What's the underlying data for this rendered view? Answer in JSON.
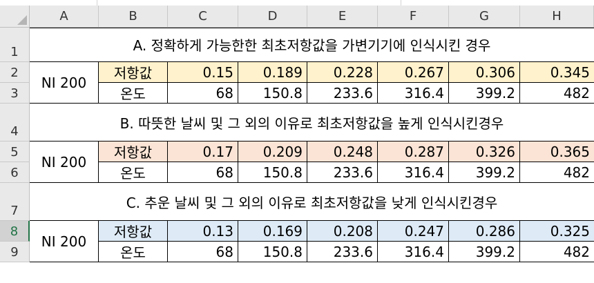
{
  "columns": [
    "A",
    "B",
    "C",
    "D",
    "E",
    "F",
    "G",
    "H"
  ],
  "rows": [
    "1",
    "2",
    "3",
    "4",
    "5",
    "6",
    "7",
    "8",
    "9"
  ],
  "selected_row": "8",
  "colors": {
    "yellow": "#fff2cc",
    "peach": "#fbe4d5",
    "blue": "#deebf7",
    "select_green": "#217346"
  },
  "sections": [
    {
      "title": "A. 정확하게 가능한한 최초저항값을 가변기기에 인식시킨 경우",
      "label": "NI 200",
      "resistance_label": "저항값",
      "resistance": [
        "0.15",
        "0.189",
        "0.228",
        "0.267",
        "0.306",
        "0.345"
      ],
      "temperature_label": "온도",
      "temperature": [
        "68",
        "150.8",
        "233.6",
        "316.4",
        "399.2",
        "482"
      ]
    },
    {
      "title": "B. 따뜻한 날씨 및 그 외의 이유로 최초저항값을 높게 인식시킨경우",
      "label": "NI 200",
      "resistance_label": "저항값",
      "resistance": [
        "0.17",
        "0.209",
        "0.248",
        "0.287",
        "0.326",
        "0.365"
      ],
      "temperature_label": "온도",
      "temperature": [
        "68",
        "150.8",
        "233.6",
        "316.4",
        "399.2",
        "482"
      ]
    },
    {
      "title": "C. 추운 날씨 및 그 외의 이유로 최초저항값을 낮게 인식시킨경우",
      "label": "NI 200",
      "resistance_label": "저항값",
      "resistance": [
        "0.13",
        "0.169",
        "0.208",
        "0.247",
        "0.286",
        "0.325"
      ],
      "temperature_label": "온도",
      "temperature": [
        "68",
        "150.8",
        "233.6",
        "316.4",
        "399.2",
        "482"
      ]
    }
  ]
}
